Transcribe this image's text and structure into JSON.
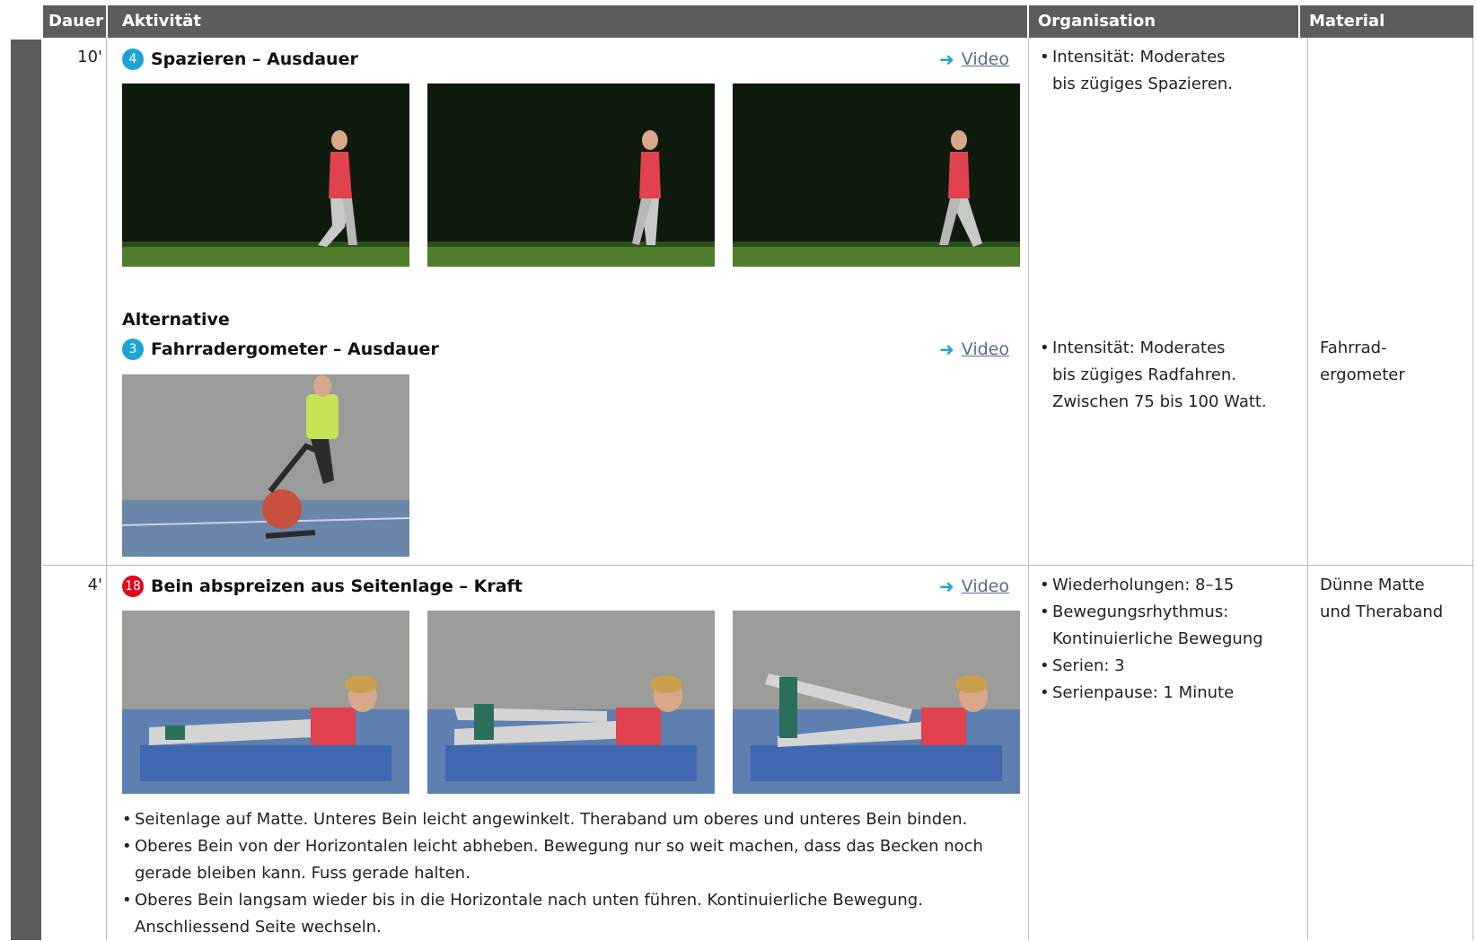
{
  "table_header": {
    "dauer": "Dauer",
    "aktivitaet": "Aktivität",
    "organisation": "Organisation",
    "material": "Material"
  },
  "rows": [
    {
      "duration": "10'",
      "exercise": {
        "number": "4",
        "title": "Spazieren – Ausdauer",
        "video_link": "Video",
        "badge_color": "#1ea3d8"
      },
      "organisation": [
        "Intensität: Moderates",
        "bis zügiges Spazieren."
      ],
      "material": "",
      "alternative": {
        "label": "Alternative",
        "exercise": {
          "number": "3",
          "title": "Fahrradergometer – Ausdauer",
          "video_link": "Video",
          "badge_color": "#1ea3d8"
        },
        "organisation": [
          "Intensität: Moderates",
          "bis zügiges Radfahren.",
          "Zwischen 75 bis 100 Watt."
        ],
        "material": [
          "Fahrrad-",
          "ergometer"
        ]
      }
    },
    {
      "duration": "4'",
      "exercise": {
        "number": "18",
        "title": "Bein abspreizen aus Seitenlage – Kraft",
        "video_link": "Video",
        "badge_color": "#e3001b"
      },
      "organisation": [
        "Wiederholungen: 8–15",
        "Bewegungsrhythmus:",
        "Kontinuierliche Bewegung",
        "Serien: 3",
        "Serienpause: 1 Minute"
      ],
      "material": [
        "Dünne Matte",
        "und Theraband"
      ],
      "description": [
        "Seitenlage auf Matte. Unteres Bein leicht angewinkelt. Theraband um oberes und unteres Bein binden.",
        "Oberes Bein von der Horizontalen leicht abheben. Bewegung nur so weit machen, dass das Becken noch",
        "gerade bleiben kann. Fuss gerade halten.",
        "Oberes Bein langsam wieder bis in die Horizontale nach unten führen. Kontinuierliche Bewegung.",
        "Anschliessend Seite wechseln."
      ]
    }
  ],
  "colors": {
    "header_bg": "#5c5c5c",
    "accent_blue": "#1ea3d8",
    "accent_red": "#e3001b",
    "grid": "#b9b9b9"
  }
}
